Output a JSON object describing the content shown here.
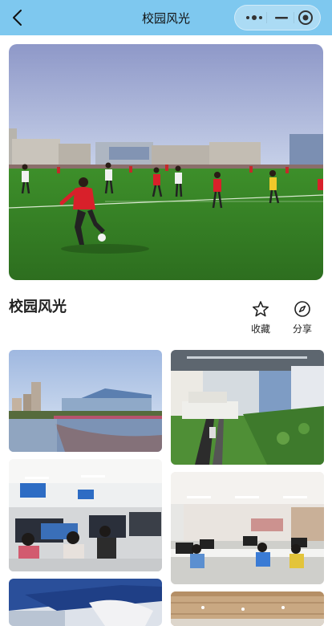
{
  "navbar": {
    "title": "校园风光",
    "back_icon": "chevron-left-icon",
    "capsule_icons": [
      "more-dots-icon",
      "minimize-icon",
      "target-icon"
    ],
    "background_color": "#7ec8ef"
  },
  "page": {
    "title": "校园风光"
  },
  "actions": {
    "favorite": {
      "label": "收藏",
      "icon": "star-outline-icon"
    },
    "share": {
      "label": "分享",
      "icon": "compass-icon"
    }
  },
  "hero": {
    "icon": "campus-football-field-photo"
  },
  "gallery": [
    {
      "icon": "campus-building-lake-photo"
    },
    {
      "icon": "campus-model-exhibit-photo"
    },
    {
      "icon": "computer-lab-photo"
    },
    {
      "icon": "computer-lab-photo"
    },
    {
      "icon": "blue-ceiling-hall-photo"
    },
    {
      "icon": "classroom-ceiling-photo"
    }
  ]
}
